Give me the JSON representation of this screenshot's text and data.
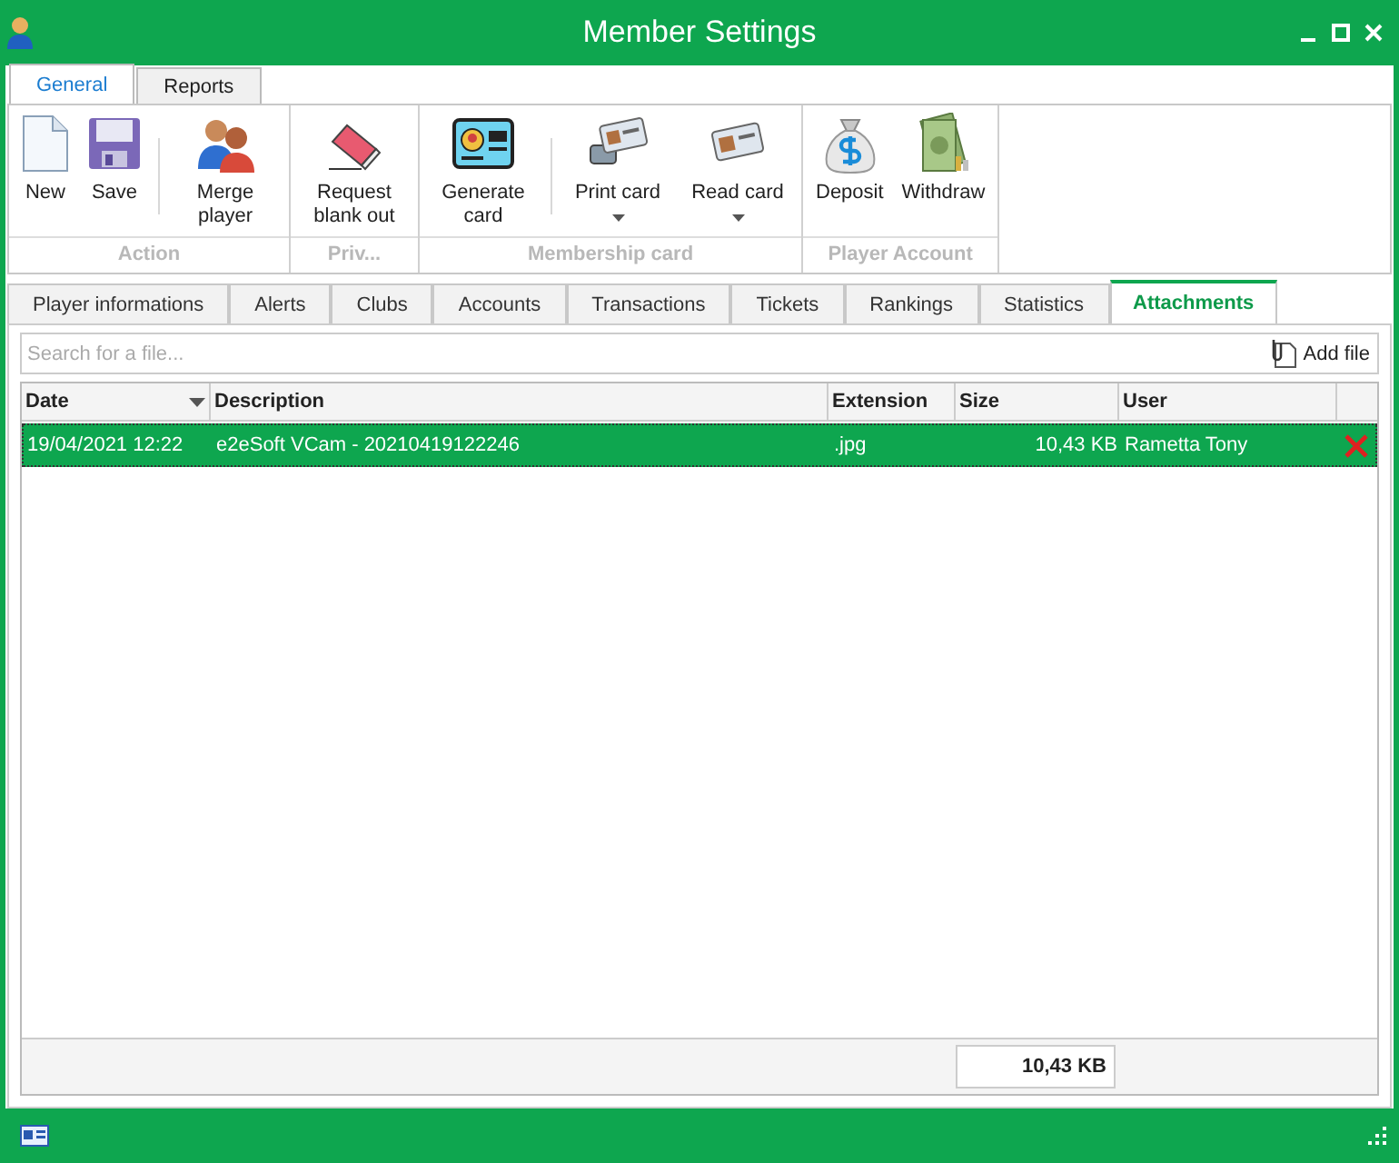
{
  "window": {
    "title": "Member Settings"
  },
  "ribbon_tabs": [
    {
      "label": "General",
      "selected": true
    },
    {
      "label": "Reports",
      "selected": false
    }
  ],
  "ribbon_groups": [
    {
      "label": "Action",
      "buttons": [
        {
          "label": "New",
          "dropdown": false,
          "separator_before": false
        },
        {
          "label": "Save",
          "dropdown": false,
          "separator_before": false
        },
        {
          "label": "Merge player",
          "dropdown": false,
          "separator_before": true
        }
      ]
    },
    {
      "label": "Priv...",
      "buttons": [
        {
          "label": "Request blank out",
          "dropdown": false,
          "separator_before": false
        }
      ]
    },
    {
      "label": "Membership card",
      "buttons": [
        {
          "label": "Generate card",
          "dropdown": false,
          "separator_before": false
        },
        {
          "label": "Print card",
          "dropdown": true,
          "separator_before": true
        },
        {
          "label": "Read card",
          "dropdown": true,
          "separator_before": false
        }
      ]
    },
    {
      "label": "Player Account",
      "buttons": [
        {
          "label": "Deposit",
          "dropdown": false,
          "separator_before": false
        },
        {
          "label": "Withdraw",
          "dropdown": false,
          "separator_before": false
        }
      ]
    }
  ],
  "tabs": [
    {
      "label": "Player informations",
      "selected": false
    },
    {
      "label": "Alerts",
      "selected": false
    },
    {
      "label": "Clubs",
      "selected": false
    },
    {
      "label": "Accounts",
      "selected": false
    },
    {
      "label": "Transactions",
      "selected": false
    },
    {
      "label": "Tickets",
      "selected": false
    },
    {
      "label": "Rankings",
      "selected": false
    },
    {
      "label": "Statistics",
      "selected": false
    },
    {
      "label": "Attachments",
      "selected": true
    }
  ],
  "search": {
    "placeholder": "Search for a file..."
  },
  "add_file_button": {
    "label": "Add file"
  },
  "table": {
    "columns": [
      "Date",
      "Description",
      "Extension",
      "Size",
      "User"
    ],
    "rows": [
      {
        "date": "19/04/2021 12:22",
        "description": "e2eSoft VCam - 20210419122246",
        "extension": ".jpg",
        "size": "10,43 KB",
        "user": "Rametta Tony",
        "selected": true
      }
    ],
    "total": "10,43 KB"
  }
}
